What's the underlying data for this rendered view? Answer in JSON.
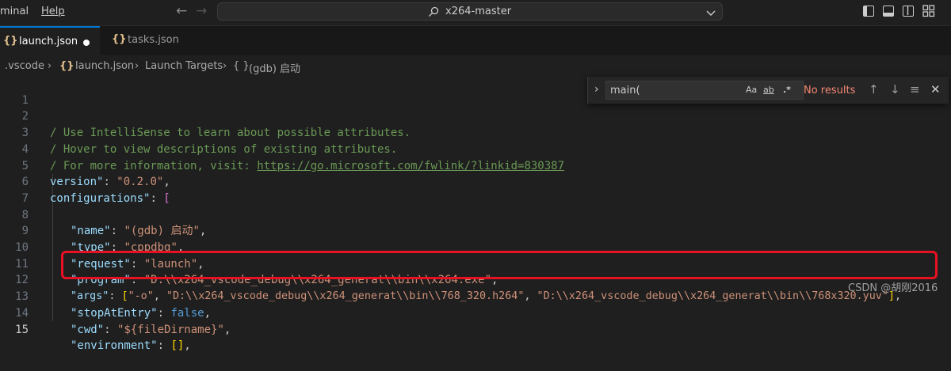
{
  "titlebar": {
    "menu": [
      "minal",
      "Help"
    ],
    "command_center": "x264-master"
  },
  "tabs": [
    {
      "label": "launch.json",
      "icon": "{}",
      "active": true,
      "dirty": true
    },
    {
      "label": "tasks.json",
      "icon": "{}",
      "active": false,
      "dirty": false
    }
  ],
  "breadcrumbs": [
    ".vscode",
    "launch.json",
    "Launch Targets",
    "(gdb) 启动"
  ],
  "breadcrumb_icons": [
    "{}",
    "{ }"
  ],
  "find": {
    "query": "main(",
    "opt_case": "Aa",
    "opt_word": "ab",
    "opt_regex": ".*",
    "status": "No results"
  },
  "editor": {
    "line_numbers": [
      "1",
      "2",
      "3",
      "4",
      "5",
      "6",
      "7",
      "8",
      "9",
      "10",
      "11",
      "12",
      "13",
      "14",
      "15"
    ],
    "current_line": "15",
    "lines": {
      "l2": "/ Use IntelliSense to learn about possible attributes.",
      "l3": "/ Hover to view descriptions of existing attributes.",
      "l4_text": "/ For more information, visit: ",
      "l4_link": "https://go.microsoft.com/fwlink/?linkid=830387",
      "l5_key": "version\"",
      "l5_sep": ": ",
      "l5_val": "\"0.2.0\"",
      "l5_end": ",",
      "l6_key": "configurations\"",
      "l6_sep": ": ",
      "l6_br": "[",
      "l7_br": "{",
      "l8_key": "\"name\"",
      "l8_val": "\"(gdb) 启动\"",
      "l9_key": "\"type\"",
      "l9_val": "\"cppdbg\"",
      "l10_key": "\"request\"",
      "l10_val": "\"launch\"",
      "l11_key": "\"program\"",
      "l11_val": "\"D:\\\\x264_vscode_debug\\\\x264_generat\\\\bin\\\\x264.exe\"",
      "l12_key": "\"args\"",
      "l12_v1": "\"-o\"",
      "l12_v2": "\"D:\\\\x264_vscode_debug\\\\x264_generat\\\\bin\\\\768_320.h264\"",
      "l12_v3": "\"D:\\\\x264_vscode_debug\\\\x264_generat\\\\bin\\\\768x320.yuv\"",
      "l13_key": "\"stopAtEntry\"",
      "l13_val": "false",
      "l14_key": "\"cwd\"",
      "l14_val": "\"${fileDirname}\"",
      "l15_key": "\"environment\"",
      "l15_val": "[]",
      "colon": ": ",
      "comma": ",",
      "sep": ", ",
      "open": "[",
      "close": "]"
    }
  },
  "watermark": "CSDN @胡刚2016",
  "colors": {
    "accent": "#0078d4",
    "highlight_box": "#e81123",
    "no_results": "#f48771"
  }
}
